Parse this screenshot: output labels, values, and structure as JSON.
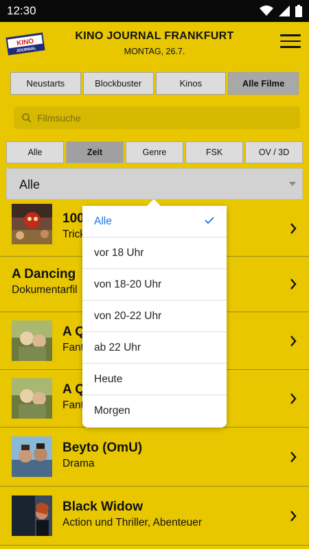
{
  "status": {
    "time": "12:30"
  },
  "header": {
    "logo_text": "KINO JOURNAL FRANKFURT",
    "title": "KINO JOURNAL FRANKFURT",
    "date": "MONTAG, 26.7."
  },
  "tabs": [
    {
      "label": "Neustarts",
      "active": false
    },
    {
      "label": "Blockbuster",
      "active": false
    },
    {
      "label": "Kinos",
      "active": false
    },
    {
      "label": "Alle Filme",
      "active": true
    }
  ],
  "search": {
    "placeholder": "Filmsuche"
  },
  "filters": [
    {
      "label": "Alle",
      "active": false
    },
    {
      "label": "Zeit",
      "active": true
    },
    {
      "label": "Genre",
      "active": false
    },
    {
      "label": "FSK",
      "active": false
    },
    {
      "label": "OV / 3D",
      "active": false
    }
  ],
  "select": {
    "value": "Alle"
  },
  "movies": [
    {
      "name": "100",
      "genre": "Trick"
    },
    {
      "name": "A Dancing",
      "genre": "Dokumentarfil"
    },
    {
      "name": "A Q",
      "genre": "Fant"
    },
    {
      "name": "A Q",
      "genre": "Fant"
    },
    {
      "name": "Beyto (OmU)",
      "genre": "Drama"
    },
    {
      "name": "Black Widow",
      "genre": "Action und Thriller, Abenteuer"
    }
  ],
  "dropdown": {
    "options": [
      "Alle",
      "vor 18 Uhr",
      "von 18-20 Uhr",
      "von 20-22 Uhr",
      "ab 22 Uhr",
      "Heute",
      "Morgen"
    ],
    "selected": "Alle"
  },
  "colors": {
    "background": "#e8c700",
    "accent": "#1a73e8"
  }
}
